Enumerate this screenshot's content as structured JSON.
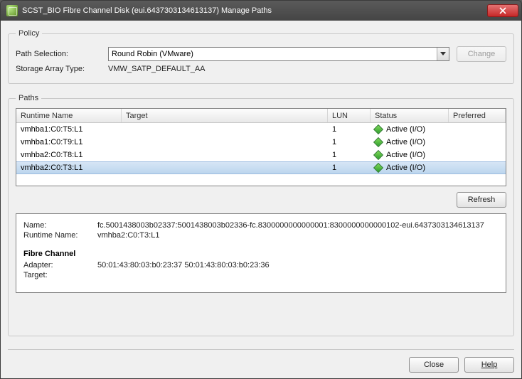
{
  "window": {
    "title": "SCST_BIO Fibre Channel Disk (eui.6437303134613137) Manage Paths"
  },
  "policy": {
    "legend": "Policy",
    "path_selection_label": "Path Selection:",
    "path_selection_value": "Round Robin (VMware)",
    "change_label": "Change",
    "storage_array_type_label": "Storage Array Type:",
    "storage_array_type_value": "VMW_SATP_DEFAULT_AA"
  },
  "paths": {
    "legend": "Paths",
    "columns": {
      "runtime": "Runtime Name",
      "target": "Target",
      "lun": "LUN",
      "status": "Status",
      "preferred": "Preferred"
    },
    "rows": [
      {
        "runtime": "vmhba1:C0:T5:L1",
        "target": "",
        "lun": "1",
        "status": "Active (I/O)",
        "preferred": "",
        "selected": false
      },
      {
        "runtime": "vmhba1:C0:T9:L1",
        "target": "",
        "lun": "1",
        "status": "Active (I/O)",
        "preferred": "",
        "selected": false
      },
      {
        "runtime": "vmhba2:C0:T8:L1",
        "target": "",
        "lun": "1",
        "status": "Active (I/O)",
        "preferred": "",
        "selected": false
      },
      {
        "runtime": "vmhba2:C0:T3:L1",
        "target": "",
        "lun": "1",
        "status": "Active (I/O)",
        "preferred": "",
        "selected": true
      }
    ],
    "refresh_label": "Refresh"
  },
  "detail": {
    "name_label": "Name:",
    "name_value": "fc.5001438003b02337:5001438003b02336-fc.8300000000000001:8300000000000102-eui.6437303134613137",
    "runtime_label": "Runtime Name:",
    "runtime_value": "vmhba2:C0:T3:L1",
    "section_title": "Fibre Channel",
    "adapter_label": "Adapter:",
    "adapter_value": "50:01:43:80:03:b0:23:37 50:01:43:80:03:b0:23:36",
    "target_label": "Target:",
    "target_value": ""
  },
  "footer": {
    "close_label": "Close",
    "help_label": "Help"
  }
}
